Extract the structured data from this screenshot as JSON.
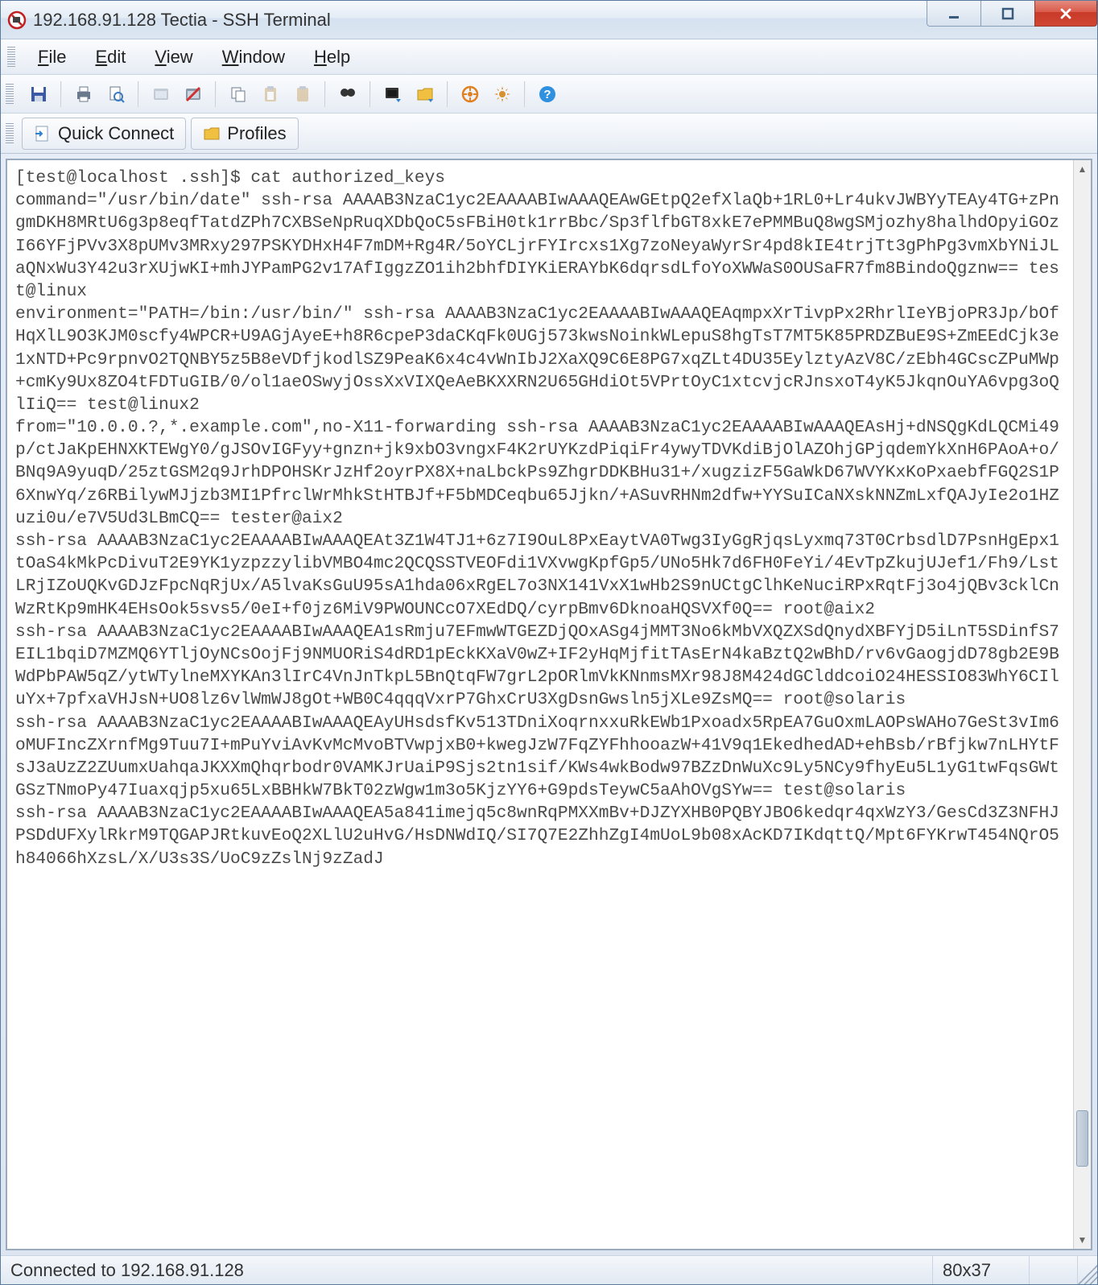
{
  "window": {
    "title": "192.168.91.128 Tectia - SSH Terminal"
  },
  "menu": {
    "file": "File",
    "edit": "Edit",
    "view": "View",
    "window": "Window",
    "help": "Help"
  },
  "toolbar": {
    "save": "save-icon",
    "print": "print-icon",
    "preview": "print-preview-icon",
    "new_term": "new-terminal-icon",
    "new_ft": "new-filetransfer-icon",
    "disconnect": "disconnect-icon",
    "copy": "copy-icon",
    "paste": "paste-icon",
    "paste_sel": "paste-selection-icon",
    "find": "find-icon",
    "term_window": "terminal-window-icon",
    "folder": "folder-icon",
    "orange": "tunneling-icon",
    "settings": "settings-icon",
    "help": "help-icon"
  },
  "quickbar": {
    "quick_connect": "Quick Connect",
    "profiles": "Profiles"
  },
  "terminal_text": "[test@localhost .ssh]$ cat authorized_keys\ncommand=\"/usr/bin/date\" ssh-rsa AAAAB3NzaC1yc2EAAAABIwAAAQEAwGEtpQ2efXlaQb+1RL0+Lr4ukvJWBYyTEAy4TG+zPngmDKH8MRtU6g3p8eqfTatdZPh7CXBSeNpRuqXDbQoC5sFBiH0tk1rrBbc/Sp3flfbGT8xkE7ePMMBuQ8wgSMjozhy8halhdOpyiGOzI66YFjPVv3X8pUMv3MRxy297PSKYDHxH4F7mDM+Rg4R/5oYCLjrFYIrcxs1Xg7zoNeyaWyrSr4pd8kIE4trjTt3gPhPg3vmXbYNiJLaQNxWu3Y42u3rXUjwKI+mhJYPamPG2v17AfIggzZO1ih2bhfDIYKiERAYbK6dqrsdLfoYoXWWaS0OUSaFR7fm8BindoQgznw== test@linux\nenvironment=\"PATH=/bin:/usr/bin/\" ssh-rsa AAAAB3NzaC1yc2EAAAABIwAAAQEAqmpxXrTivpPx2RhrlIeYBjoPR3Jp/bOfHqXlL9O3KJM0scfy4WPCR+U9AGjAyeE+h8R6cpeP3daCKqFk0UGj573kwsNoinkWLepuS8hgTsT7MT5K85PRDZBuE9S+ZmEEdCjk3e1xNTD+Pc9rpnvO2TQNBY5z5B8eVDfjkodlSZ9PeaK6x4c4vWnIbJ2XaXQ9C6E8PG7xqZLt4DU35EylztyAzV8C/zEbh4GCscZPuMWp+cmKy9Ux8ZO4tFDTuGIB/0/ol1aeOSwyjOssXxVIXQeAeBKXXRN2U65GHdiOt5VPrtOyC1xtcvjcRJnsxoT4yK5JkqnOuYA6vpg3oQlIiQ== test@linux2\nfrom=\"10.0.0.?,*.example.com\",no-X11-forwarding ssh-rsa AAAAB3NzaC1yc2EAAAABIwAAAQEAsHj+dNSQgKdLQCMi49p/ctJaKpEHNXKTEWgY0/gJSOvIGFyy+gnzn+jk9xbO3vngxF4K2rUYKzdPiqiFr4ywyTDVKdiBjOlAZOhjGPjqdemYkXnH6PAoA+o/BNq9A9yuqD/25ztGSM2q9JrhDPOHSKrJzHf2oyrPX8X+naLbckPs9ZhgrDDKBHu31+/xugzizF5GaWkD67WVYKxKoPxaebfFGQ2S1P6XnwYq/z6RBilywMJjzb3MI1PfrclWrMhkStHTBJf+F5bMDCeqbu65Jjkn/+ASuvRHNm2dfw+YYSuICaNXskNNZmLxfQAJyIe2o1HZuzi0u/e7V5Ud3LBmCQ== tester@aix2\nssh-rsa AAAAB3NzaC1yc2EAAAABIwAAAQEAt3Z1W4TJ1+6z7I9OuL8PxEaytVA0Twg3IyGgRjqsLyxmq73T0CrbsdlD7PsnHgEpx1tOaS4kMkPcDivuT2E9YK1yzpzzylibVMBO4mc2QCQSSTVEOFdi1VXvwgKpfGp5/UNo5Hk7d6FH0FeYi/4EvTpZkujUJef1/Fh9/LstLRjIZoUQKvGDJzFpcNqRjUx/A5lvaKsGuU95sA1hda06xRgEL7o3NX141VxX1wHb2S9nUCtgClhKeNuciRPxRqtFj3o4jQBv3cklCnWzRtKp9mHK4EHsOok5svs5/0eI+f0jz6MiV9PWOUNCcO7XEdDQ/cyrpBmv6DknoaHQSVXf0Q== root@aix2\nssh-rsa AAAAB3NzaC1yc2EAAAABIwAAAQEA1sRmju7EFmwWTGEZDjQOxASg4jMMT3No6kMbVXQZXSdQnydXBFYjD5iLnT5SDinfS7EIL1bqiD7MZMQ6YTljOyNCsOojFj9NMUORiS4dRD1pEckKXaV0wZ+IF2yHqMjfitTAsErN4kaBztQ2wBhD/rv6vGaogjdD78gb2E9BWdPbPAW5qZ/ytWTylneMXYKAn3lIrC4VnJnTkpL5BnQtqFW7grL2pORlmVkKNnmsMXr98J8M424dGClddcoiO24HESSIO83WhY6CIluYx+7pfxaVHJsN+UO8lz6vlWmWJ8gOt+WB0C4qqqVxrP7GhxCrU3XgDsnGwsln5jXLe9ZsMQ== root@solaris\nssh-rsa AAAAB3NzaC1yc2EAAAABIwAAAQEAyUHsdsfKv513TDniXoqrnxxuRkEWb1Pxoadx5RpEA7GuOxmLAOPsWAHo7GeSt3vIm6oMUFIncZXrnfMg9Tuu7I+mPuYviAvKvMcMvoBTVwpjxB0+kwegJzW7FqZYFhhooazW+41V9q1EkedhedAD+ehBsb/rBfjkw7nLHYtFsJ3aUzZ2ZUumxUahqaJKXXmQhqrbodr0VAMKJrUaiP9Sjs2tn1sif/KWs4wkBodw97BZzDnWuXc9Ly5NCy9fhyEu5L1yG1twFqsGWtGSzTNmoPy47Iuaxqjp5xu65LxBBHkW7BkT02zWgw1m3o5KjzYY6+G9pdsTeywC5aAhOVgSYw== test@solaris\nssh-rsa AAAAB3NzaC1yc2EAAAABIwAAAQEA5a841imejq5c8wnRqPMXXmBv+DJZYXHB0PQBYJBO6kedqr4qxWzY3/GesCd3Z3NFHJPSDdUFXylRkrM9TQGAPJRtkuvEoQ2XLlU2uHvG/HsDNWdIQ/SI7Q7E2ZhhZgI4mUoL9b08xAcKD7IKdqttQ/Mpt6FYKrwT454NQrO5h84066hXzsL/X/U3s3S/UoC9zZslNj9zZadJ",
  "status": {
    "connected": "Connected to 192.168.91.128",
    "dimensions": "80x37"
  }
}
